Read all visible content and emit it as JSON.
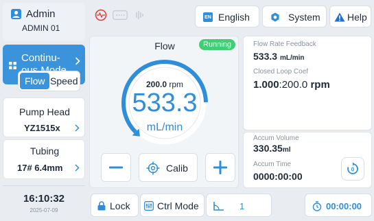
{
  "user": {
    "role": "Admin",
    "name": "ADMIN 01"
  },
  "mode": {
    "label_line1": "Continu-",
    "label_line2": "ous Mode"
  },
  "flow_speed": {
    "flow": "Flow",
    "speed": "Speed",
    "selected": "Flow"
  },
  "pump_head": {
    "label": "Pump Head",
    "value": "YZ1515x"
  },
  "tubing": {
    "label": "Tubing",
    "value": "17# 6.4mm"
  },
  "clock": {
    "time": "16:10:32",
    "date": "2025-07-09"
  },
  "header": {
    "language": "English",
    "language_badge": "EN",
    "system": "System",
    "help": "Help"
  },
  "flow_panel": {
    "title": "Flow",
    "status": "Running",
    "rpm_value": "200.0",
    "rpm_unit": "rpm",
    "flow_value": "533.3",
    "flow_unit": "mL/min",
    "calib": "Calib",
    "dial_progress_fraction": 0.8
  },
  "feedback": {
    "flow_rate_label": "Flow Rate Feedback",
    "flow_rate_value": "533.3",
    "flow_rate_unit": "mL/min",
    "coef_label": "Closed Loop Coef",
    "coef_value": "1.000",
    "coef_suffix": ":200.0",
    "coef_unit": "rpm"
  },
  "accum": {
    "volume_label": "Accum Volume",
    "volume_value": "330.35",
    "volume_unit": "ml",
    "time_label": "Accum Time",
    "time_value": "0000:00:00"
  },
  "footer": {
    "lock": "Lock",
    "ctrl_mode": "Ctrl Mode",
    "ramp_value": "1",
    "timer": "00:00:00"
  },
  "colors": {
    "accent": "#2f8ed9",
    "running": "#3fcf74",
    "error": "#e53935",
    "help_warning": "#1e6fd0"
  }
}
